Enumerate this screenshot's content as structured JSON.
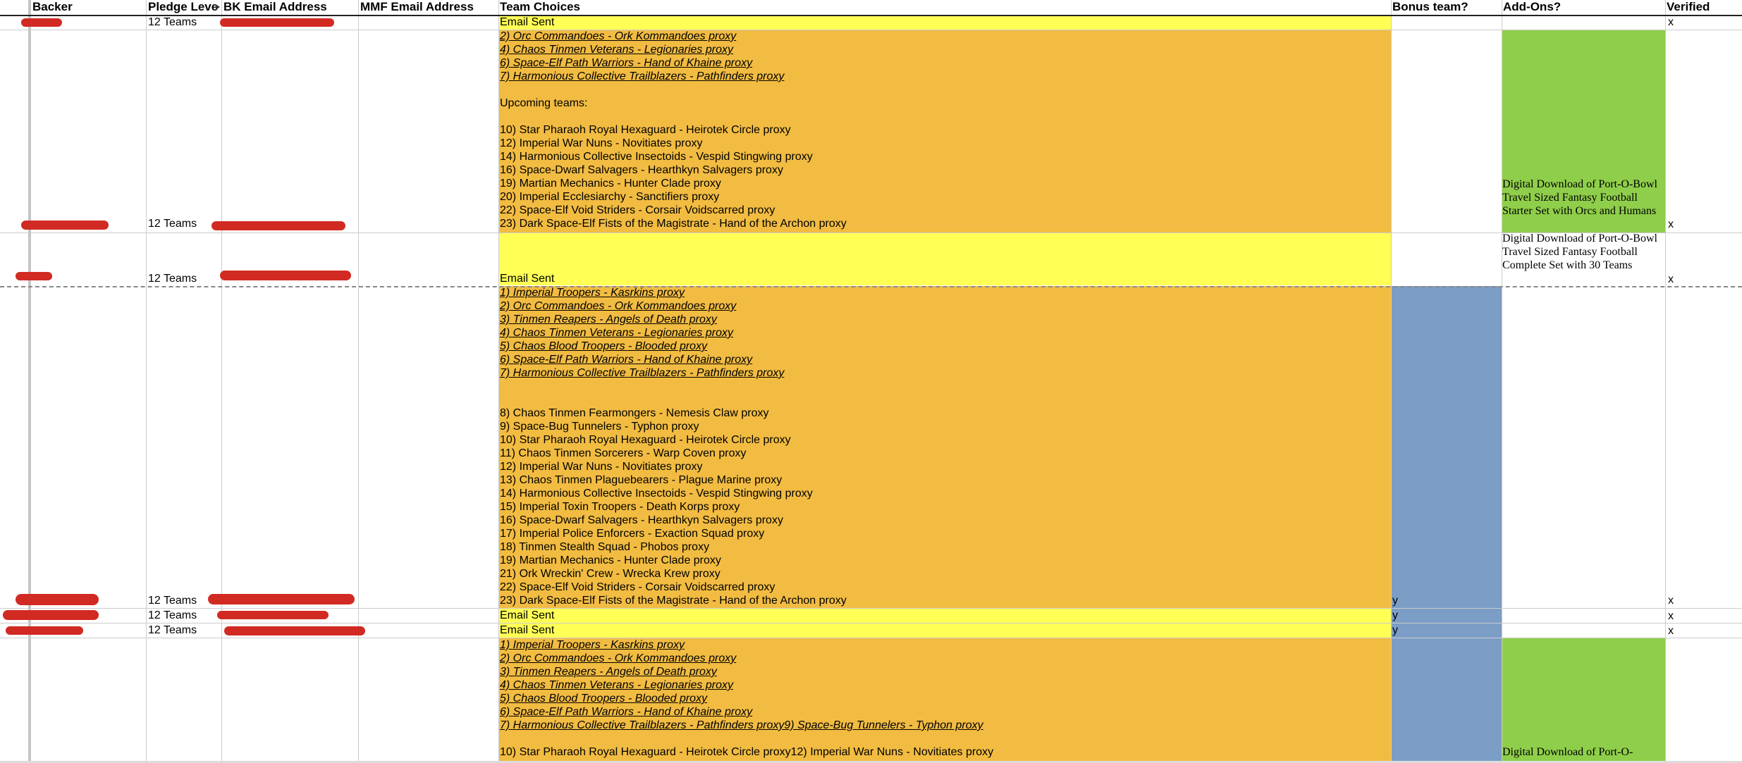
{
  "colors": {
    "yellow": "#ffff55",
    "orange": "#f2bc42",
    "blue": "#7b9dc6",
    "green": "#8fce4a",
    "grid": "#cccccc",
    "redaction": "#d12a22"
  },
  "columns": [
    "Backer",
    "Pledge Level",
    "BK Email Address",
    "MMF Email Address",
    "Team Choices",
    "Bonus team?",
    "Add-Ons?",
    "Verified"
  ],
  "common": {
    "pledge": "12 Teams",
    "email_sent": "Email Sent",
    "verified_mark": "x",
    "bonus_mark": "y",
    "upcoming": "Upcoming teams:",
    "addon_starter": "Digital Download of Port-O-Bowl Travel Sized Fantasy Football Starter Set with Orcs and Humans",
    "addon_complete": "Digital Download of Port-O-Bowl Travel Sized Fantasy Football Complete Set with 30 Teams",
    "addon_partial": "Digital Download of Port-O-"
  },
  "rows": {
    "r2": {
      "proxies": [
        "2) Orc Commandoes - Ork Kommandoes proxy",
        "4) Chaos Tinmen Veterans - Legionaries proxy",
        "6) Space-Elf Path Warriors - Hand of Khaine proxy",
        "7) Harmonious Collective Trailblazers - Pathfinders proxy"
      ],
      "upcoming": [
        "10) Star Pharaoh Royal Hexaguard - Heirotek Circle proxy",
        "12) Imperial War Nuns - Novitiates proxy",
        "14) Harmonious Collective Insectoids - Vespid Stingwing proxy",
        "16) Space-Dwarf Salvagers - Hearthkyn Salvagers proxy",
        "19) Martian Mechanics - Hunter Clade proxy",
        "20) Imperial Ecclesiarchy - Sanctifiers proxy",
        "22) Space-Elf Void Striders - Corsair Voidscarred proxy",
        "23) Dark Space-Elf Fists of the Magistrate - Hand of the Archon proxy"
      ]
    },
    "r4": {
      "proxies": [
        "1) Imperial Troopers - Kasrkins proxy",
        "2) Orc Commandoes - Ork Kommandoes proxy",
        "3) Tinmen Reapers - Angels of Death proxy",
        "4) Chaos Tinmen Veterans - Legionaries proxy",
        "5) Chaos Blood Troopers - Blooded proxy",
        "6) Space-Elf Path Warriors - Hand of Khaine proxy",
        "7) Harmonious Collective Trailblazers - Pathfinders proxy"
      ],
      "upcoming": [
        "8) Chaos Tinmen Fearmongers - Nemesis Claw proxy",
        "9)  Space-Bug Tunnelers - Typhon proxy",
        "10) Star Pharaoh Royal Hexaguard - Heirotek Circle proxy",
        "11) Chaos Tinmen Sorcerers - Warp Coven proxy",
        "12) Imperial War Nuns - Novitiates proxy",
        "13) Chaos Tinmen Plaguebearers - Plague Marine proxy",
        "14) Harmonious Collective Insectoids - Vespid Stingwing proxy",
        "15) Imperial Toxin Troopers - Death Korps proxy",
        "16) Space-Dwarf Salvagers - Hearthkyn Salvagers proxy",
        "17) Imperial Police Enforcers - Exaction Squad proxy",
        "18) Tinmen Stealth Squad - Phobos proxy",
        "19) Martian Mechanics - Hunter Clade proxy",
        "21) Ork Wreckin' Crew - Wrecka Krew proxy",
        "22) Space-Elf Void Striders - Corsair Voidscarred proxy",
        "23) Dark Space-Elf Fists of the Magistrate - Hand of the Archon proxy"
      ]
    },
    "r7": {
      "proxies": [
        "1) Imperial Troopers - Kasrkins proxy",
        "2) Orc Commandoes - Ork Kommandoes proxy",
        "3) Tinmen Reapers - Angels of Death proxy",
        "4) Chaos Tinmen Veterans - Legionaries proxy",
        "5) Chaos Blood Troopers - Blooded proxy",
        "6) Space-Elf Path Warriors - Hand of Khaine proxy",
        "7) Harmonious Collective Trailblazers - Pathfinders proxy9)  Space-Bug Tunnelers - Typhon proxy"
      ],
      "upcoming": [
        "10) Star Pharaoh Royal Hexaguard - Heirotek Circle proxy12) Imperial War Nuns - Novitiates proxy"
      ]
    }
  }
}
